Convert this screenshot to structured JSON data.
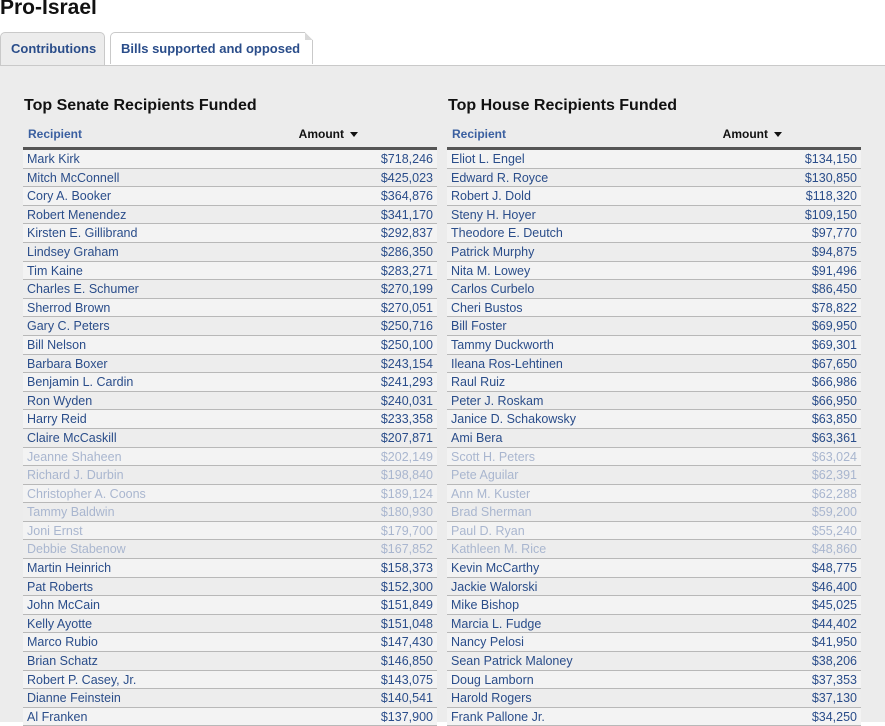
{
  "page": {
    "title": "Pro-Israel"
  },
  "tabs": [
    {
      "label": "Contributions"
    },
    {
      "label": "Bills supported and opposed"
    }
  ],
  "senate": {
    "title": "Top Senate Recipients Funded",
    "col_recipient": "Recipient",
    "col_amount": "Amount",
    "rows": [
      {
        "name": "Mark Kirk",
        "amount": "$718,246"
      },
      {
        "name": "Mitch McConnell",
        "amount": "$425,023"
      },
      {
        "name": "Cory A. Booker",
        "amount": "$364,876"
      },
      {
        "name": "Robert Menendez",
        "amount": "$341,170"
      },
      {
        "name": "Kirsten E. Gillibrand",
        "amount": "$292,837"
      },
      {
        "name": "Lindsey Graham",
        "amount": "$286,350"
      },
      {
        "name": "Tim Kaine",
        "amount": "$283,271"
      },
      {
        "name": "Charles E. Schumer",
        "amount": "$270,199"
      },
      {
        "name": "Sherrod Brown",
        "amount": "$270,051"
      },
      {
        "name": "Gary C. Peters",
        "amount": "$250,716"
      },
      {
        "name": "Bill Nelson",
        "amount": "$250,100"
      },
      {
        "name": "Barbara Boxer",
        "amount": "$243,154"
      },
      {
        "name": "Benjamin L. Cardin",
        "amount": "$241,293"
      },
      {
        "name": "Ron Wyden",
        "amount": "$240,031"
      },
      {
        "name": "Harry Reid",
        "amount": "$233,358"
      },
      {
        "name": "Claire McCaskill",
        "amount": "$207,871"
      },
      {
        "name": "Jeanne Shaheen",
        "amount": "$202,149"
      },
      {
        "name": "Richard J. Durbin",
        "amount": "$198,840"
      },
      {
        "name": "Christopher A. Coons",
        "amount": "$189,124"
      },
      {
        "name": "Tammy Baldwin",
        "amount": "$180,930"
      },
      {
        "name": "Joni Ernst",
        "amount": "$179,700"
      },
      {
        "name": "Debbie Stabenow",
        "amount": "$167,852"
      },
      {
        "name": "Martin Heinrich",
        "amount": "$158,373"
      },
      {
        "name": "Pat Roberts",
        "amount": "$152,300"
      },
      {
        "name": "John McCain",
        "amount": "$151,849"
      },
      {
        "name": "Kelly Ayotte",
        "amount": "$151,048"
      },
      {
        "name": "Marco Rubio",
        "amount": "$147,430"
      },
      {
        "name": "Brian Schatz",
        "amount": "$146,850"
      },
      {
        "name": "Robert P. Casey, Jr.",
        "amount": "$143,075"
      },
      {
        "name": "Dianne Feinstein",
        "amount": "$140,541"
      },
      {
        "name": "Al Franken",
        "amount": "$137,900"
      }
    ]
  },
  "house": {
    "title": "Top House Recipients Funded",
    "col_recipient": "Recipient",
    "col_amount": "Amount",
    "rows": [
      {
        "name": "Eliot L. Engel",
        "amount": "$134,150"
      },
      {
        "name": "Edward R. Royce",
        "amount": "$130,850"
      },
      {
        "name": "Robert J. Dold",
        "amount": "$118,320"
      },
      {
        "name": "Steny H. Hoyer",
        "amount": "$109,150"
      },
      {
        "name": "Theodore E. Deutch",
        "amount": "$97,770"
      },
      {
        "name": "Patrick Murphy",
        "amount": "$94,875"
      },
      {
        "name": "Nita M. Lowey",
        "amount": "$91,496"
      },
      {
        "name": "Carlos Curbelo",
        "amount": "$86,450"
      },
      {
        "name": "Cheri Bustos",
        "amount": "$78,822"
      },
      {
        "name": "Bill Foster",
        "amount": "$69,950"
      },
      {
        "name": "Tammy Duckworth",
        "amount": "$69,301"
      },
      {
        "name": "Ileana Ros-Lehtinen",
        "amount": "$67,650"
      },
      {
        "name": "Raul Ruiz",
        "amount": "$66,986"
      },
      {
        "name": "Peter J. Roskam",
        "amount": "$66,950"
      },
      {
        "name": "Janice D. Schakowsky",
        "amount": "$63,850"
      },
      {
        "name": "Ami Bera",
        "amount": "$63,361"
      },
      {
        "name": "Scott H. Peters",
        "amount": "$63,024"
      },
      {
        "name": "Pete Aguilar",
        "amount": "$62,391"
      },
      {
        "name": "Ann M. Kuster",
        "amount": "$62,288"
      },
      {
        "name": "Brad Sherman",
        "amount": "$59,200"
      },
      {
        "name": "Paul D. Ryan",
        "amount": "$55,240"
      },
      {
        "name": "Kathleen M. Rice",
        "amount": "$48,860"
      },
      {
        "name": "Kevin McCarthy",
        "amount": "$48,775"
      },
      {
        "name": "Jackie Walorski",
        "amount": "$46,400"
      },
      {
        "name": "Mike Bishop",
        "amount": "$45,025"
      },
      {
        "name": "Marcia L. Fudge",
        "amount": "$44,402"
      },
      {
        "name": "Nancy Pelosi",
        "amount": "$41,950"
      },
      {
        "name": "Sean Patrick Maloney",
        "amount": "$38,206"
      },
      {
        "name": "Doug Lamborn",
        "amount": "$37,353"
      },
      {
        "name": "Harold Rogers",
        "amount": "$37,130"
      },
      {
        "name": "Frank Pallone Jr.",
        "amount": "$34,250"
      }
    ]
  }
}
